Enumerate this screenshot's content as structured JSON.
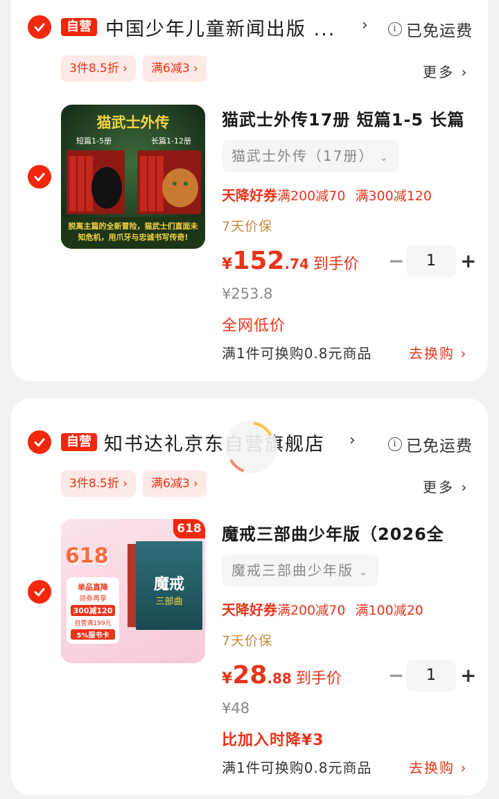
{
  "stores": [
    {
      "ziying": "自营",
      "shop_name": "中国少年儿童新闻出版 ...",
      "free_shipping": "已免运费",
      "promos": [
        "3件8.5折",
        "满6减3"
      ],
      "more": "更多",
      "item": {
        "title": "猫武士外传17册 短篇1-5 长篇",
        "spec": "猫武士外传（17册）",
        "coupon_label": "天降好券",
        "coupons": [
          "满200减70",
          "满300减120"
        ],
        "guarantee": "7天价保",
        "price_currency": "¥",
        "price_int": "152",
        "price_dec": ".74",
        "price_label": "到手价",
        "original_price": "¥253.8",
        "price_tag": "全网低价",
        "quantity": "1",
        "exchange_text": "满1件可换购0.8元商品",
        "exchange_button": "去换购",
        "image": {
          "title": "猫武士外传",
          "left_label": "短篇1-5册",
          "right_label": "长篇1-12册",
          "caption": "脱离主篇的全新冒险，猫武士们直面未知危机，用爪牙与忠诚书写传奇!"
        }
      }
    },
    {
      "ziying": "自营",
      "shop_name": "知书达礼京东自营旗舰店",
      "free_shipping": "已免运费",
      "promos": [
        "3件8.5折",
        "满6减3"
      ],
      "more": "更多",
      "item": {
        "title": "魔戒三部曲少年版（2026全",
        "spec": "魔戒三部曲少年版",
        "coupon_label": "天降好券",
        "coupons": [
          "满200减70",
          "满100减20"
        ],
        "guarantee": "7天价保",
        "price_currency": "¥",
        "price_int": "28",
        "price_dec": ".88",
        "price_label": "到手价",
        "original_price": "¥48",
        "price_tag": "比加入时降¥3",
        "quantity": "1",
        "exchange_text": "满1件可换购0.8元商品",
        "exchange_button": "去换购",
        "image": {
          "badge": "618",
          "big_618": "618",
          "line1": "单品直降",
          "line2": "领券再享",
          "line3": "300减120",
          "line4": "自营满199元",
          "line5": "5%服书卡",
          "book_title": "魔戒",
          "book_sub": "三部曲"
        }
      }
    }
  ],
  "colors": {
    "accent": "#f2270c",
    "price": "#e8341a",
    "promo_bg": "#fde9e6",
    "guarantee": "#c8893a",
    "page_bg": "#f2f2f2"
  }
}
